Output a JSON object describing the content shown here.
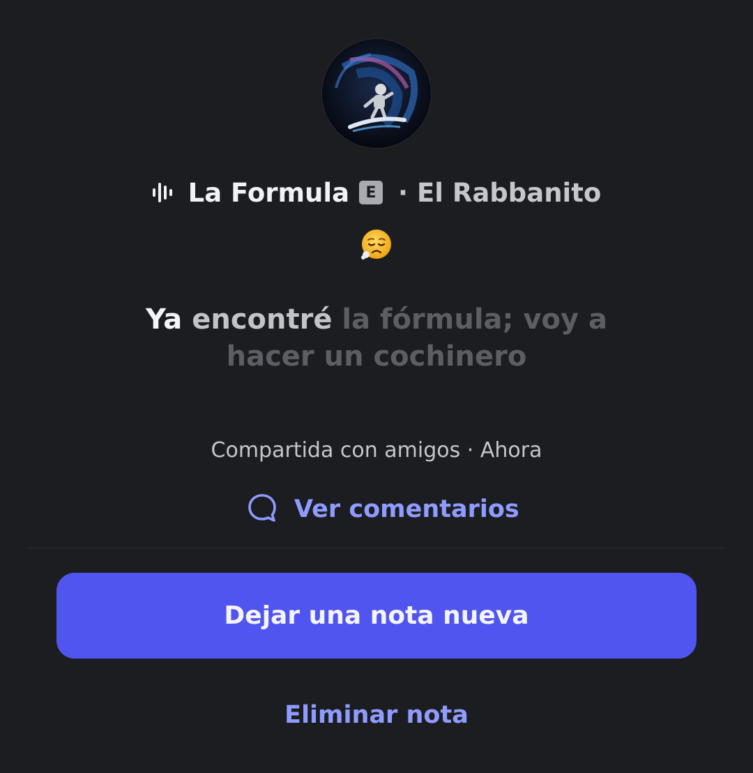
{
  "note": {
    "song": {
      "icon": "music-bars-icon",
      "title": "La Formula",
      "explicit_badge": "E",
      "artist": "· El Rabbanito"
    },
    "emoji": "sad-relieved-face-emoji",
    "text": {
      "active": "Ya",
      "faded": "encontré",
      "upcoming": "la fórmula; voy a hacer un cochinero"
    },
    "meta": "Compartida con amigos · Ahora"
  },
  "actions": {
    "comments_icon": "speech-bubble-icon",
    "comments_label": "Ver comentarios",
    "new_note_label": "Dejar una nota nueva",
    "delete_label": "Eliminar nota"
  },
  "colors": {
    "background": "#1c1d21",
    "accent_button": "#5155f0",
    "link": "#8f9cff"
  }
}
